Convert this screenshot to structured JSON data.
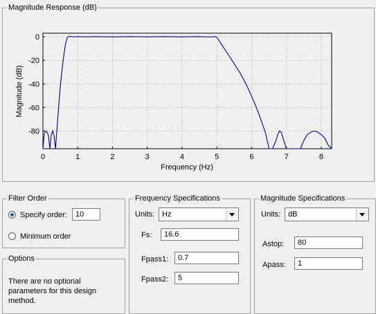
{
  "response_panel": {
    "title": "Magnitude Response (dB)"
  },
  "chart_data": {
    "type": "line",
    "xlabel": "Frequency (Hz)",
    "ylabel": "Magnitude (dB)",
    "xlim": [
      0,
      8.3
    ],
    "ylim": [
      -95,
      3
    ],
    "xticks": [
      0,
      1,
      2,
      3,
      4,
      5,
      6,
      7,
      8
    ],
    "yticks": [
      0,
      -20,
      -40,
      -60,
      -80
    ],
    "grid": true,
    "line_color": "#00008b",
    "series": [
      {
        "x": [
          0.0,
          0.04,
          0.08,
          0.12,
          0.16,
          0.2,
          0.24,
          0.28,
          0.32,
          0.36,
          0.4,
          0.45,
          0.5,
          0.55,
          0.6,
          0.65,
          0.7,
          0.72,
          0.8,
          0.9,
          1.0,
          1.2,
          1.5,
          2.0,
          2.5,
          3.0,
          3.5,
          4.0,
          4.5,
          4.8,
          4.95,
          5.0,
          5.1,
          5.2,
          5.3,
          5.4,
          5.5,
          5.6,
          5.7,
          5.8,
          5.9,
          6.0,
          6.1,
          6.2,
          6.3,
          6.4,
          6.5,
          6.6,
          6.7,
          6.75,
          6.8,
          6.85,
          6.9,
          7.0,
          7.1,
          7.2,
          7.3,
          7.4,
          7.5,
          7.6,
          7.7,
          7.8,
          7.9,
          8.0,
          8.1,
          8.2,
          8.3
        ],
        "y": [
          -95,
          -82,
          -80,
          -81,
          -84,
          -95,
          -83,
          -80,
          -84,
          -95,
          -80,
          -60,
          -42,
          -28,
          -16,
          -6,
          -0.5,
          0,
          0.3,
          -0.2,
          0.2,
          -0.1,
          0.1,
          -0.1,
          0.1,
          -0.1,
          0.1,
          -0.1,
          0.1,
          -0.2,
          0.2,
          -0.5,
          -5,
          -9.5,
          -14,
          -18.5,
          -23,
          -27.5,
          -32.5,
          -38,
          -44,
          -50.5,
          -57.5,
          -65,
          -73,
          -82,
          -95,
          -95,
          -88,
          -83,
          -80,
          -81,
          -86,
          -95,
          -95,
          -95,
          -95,
          -95,
          -88,
          -83,
          -81,
          -80,
          -81,
          -83,
          -86,
          -92,
          -95
        ]
      }
    ]
  },
  "filter_order": {
    "title": "Filter Order",
    "specify_label": "Specify order:",
    "order_value": "10",
    "minimum_label": "Minimum order"
  },
  "options": {
    "title": "Options",
    "message": "There are no optional parameters for this design method."
  },
  "freq_specs": {
    "title": "Frequency Specifications",
    "units_label": "Units:",
    "units_value": "Hz",
    "fs_label": "Fs:",
    "fs_value": "16.6",
    "fpass1_label": "Fpass1:",
    "fpass1_value": "0.7",
    "fpass2_label": "Fpass2:",
    "fpass2_value": "5"
  },
  "mag_specs": {
    "title": "Magnitude Specifications",
    "units_label": "Units:",
    "units_value": "dB",
    "astop_label": "Astop:",
    "astop_value": "80",
    "apass_label": "Apass:",
    "apass_value": "1"
  }
}
